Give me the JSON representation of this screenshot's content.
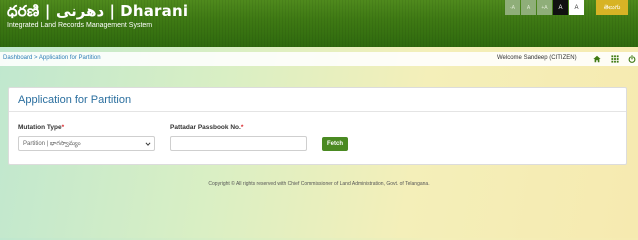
{
  "header": {
    "brand": "ధరణి | دھرنی | Dharani",
    "tagline": "Integrated Land Records Management System",
    "font_controls": [
      "-A",
      "A",
      "+A",
      "A",
      "A"
    ],
    "language_button": "తెలుగు"
  },
  "breadcrumb": {
    "text": "Dashboard > Application for Partition"
  },
  "user_bar": {
    "welcome": "Welcome  Sandeep (CITIZEN)",
    "icons": [
      "home-icon",
      "apps-grid-icon",
      "power-icon"
    ]
  },
  "form": {
    "title": "Application for Partition",
    "mutation_type": {
      "label": "Mutation Type",
      "required_mark": "*",
      "selected": "Partition | భాగస్వామ్యం"
    },
    "passbook": {
      "label": "Pattadar Passbook No.",
      "required_mark": "*",
      "value": "",
      "placeholder": ""
    },
    "fetch_label": "Fetch"
  },
  "footer": {
    "text": "Copyright © All rights reserved with Chief Commissioner of Land Administration, Govt. of Telangana."
  },
  "colors": {
    "header_green": "#3f7a14",
    "button_green": "#4a8a22",
    "title_blue": "#2b6f9f",
    "link_blue": "#2f7fb7",
    "language_gold": "#d7b325",
    "required_red": "#d9262b"
  }
}
